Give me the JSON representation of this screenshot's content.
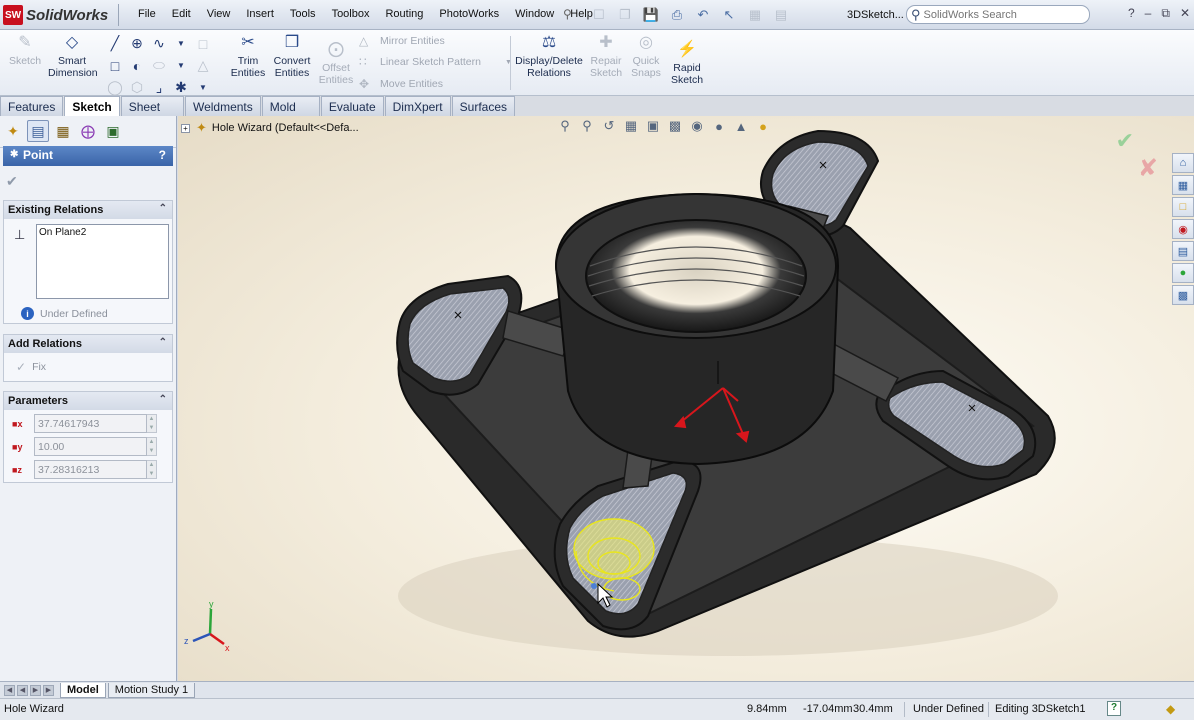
{
  "app": {
    "name": "SolidWorks",
    "logo_mark": "SW",
    "menus": [
      "File",
      "Edit",
      "View",
      "Insert",
      "Tools",
      "Toolbox",
      "Routing",
      "PhotoWorks",
      "Window",
      "Help"
    ],
    "document_title": "3DSketch...",
    "search": {
      "placeholder": "SolidWorks Search"
    }
  },
  "commands": {
    "sketch": "Sketch",
    "smart_dimension": [
      "Smart",
      "Dimension"
    ],
    "trim_entities": [
      "Trim",
      "Entities"
    ],
    "convert_entities": [
      "Convert",
      "Entities"
    ],
    "offset_entities": [
      "Offset",
      "Entities"
    ],
    "mirror_entities": "Mirror Entities",
    "linear_sketch_pattern": "Linear Sketch Pattern",
    "move_entities": "Move Entities",
    "display_delete_relations": [
      "Display/Delete",
      "Relations"
    ],
    "repair_sketch": [
      "Repair",
      "Sketch"
    ],
    "quick_snaps": [
      "Quick",
      "Snaps"
    ],
    "rapid_sketch": [
      "Rapid",
      "Sketch"
    ]
  },
  "tabs": [
    {
      "label": "Features",
      "active": false
    },
    {
      "label": "Sketch",
      "active": true
    },
    {
      "label": "Sheet Metal",
      "active": false
    },
    {
      "label": "Weldments",
      "active": false
    },
    {
      "label": "Mold Tools",
      "active": false
    },
    {
      "label": "Evaluate",
      "active": false
    },
    {
      "label": "DimXpert",
      "active": false
    },
    {
      "label": "Surfaces",
      "active": false
    }
  ],
  "property_manager": {
    "title": "Point",
    "help": "?",
    "existing_relations": {
      "label": "Existing Relations",
      "items": [
        "On Plane2"
      ],
      "status": "Under Defined"
    },
    "add_relations": {
      "label": "Add Relations",
      "fix": "Fix"
    },
    "parameters": {
      "label": "Parameters",
      "rows": [
        {
          "axis": "x",
          "value": "37.74617943"
        },
        {
          "axis": "y",
          "value": "10.00"
        },
        {
          "axis": "z",
          "value": "37.28316213"
        }
      ]
    }
  },
  "viewport": {
    "tree_item": "Hole Wizard  (Default<<Defa...",
    "triad": {
      "x": "x",
      "y": "y",
      "z": "z"
    }
  },
  "bottom_tabs": [
    {
      "label": "Model",
      "active": true
    },
    {
      "label": "Motion Study 1",
      "active": false
    }
  ],
  "status": {
    "message": "Hole Wizard",
    "x": "9.84mm",
    "y": "-17.04mm",
    "z": "30.4mm",
    "definition": "Under Defined",
    "editing": "Editing 3DSketch1",
    "help": "?"
  },
  "colors": {
    "accent": "#3a64a8",
    "axis_red": "#c0181f",
    "selection_yellow": "#f3f06b"
  }
}
